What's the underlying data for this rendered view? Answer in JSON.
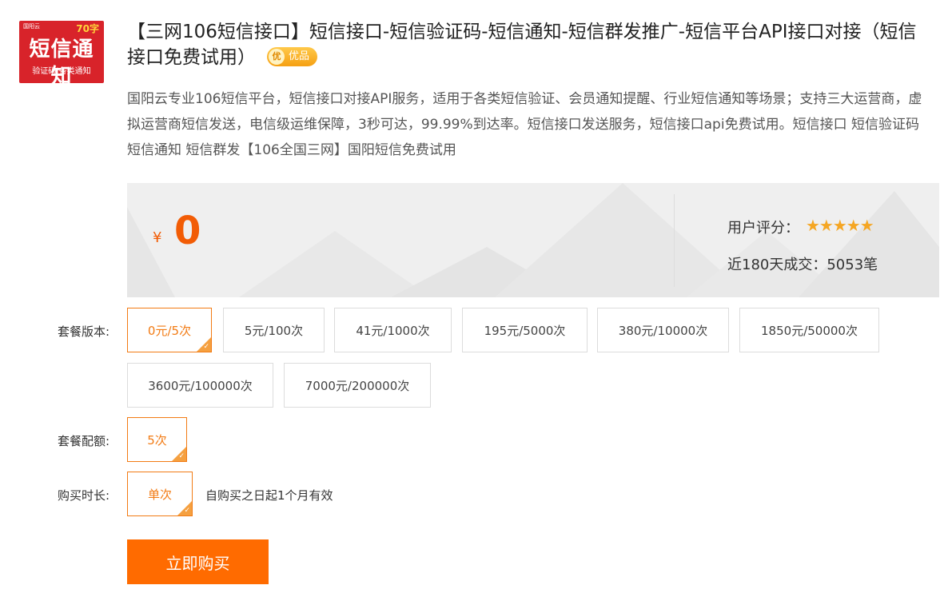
{
  "thumbnail": {
    "logo": "国阳云",
    "chars_badge": "70字",
    "title": "短信通知",
    "subtitle": "验证码|各类通知"
  },
  "product": {
    "title": "【三网106短信接口】短信接口-短信验证码-短信通知-短信群发推广-短信平台API接口对接（短信接口免费试用）",
    "badge_icon": "优",
    "badge": "优品",
    "description": "国阳云专业106短信平台，短信接口对接API服务，适用于各类短信验证、会员通知提醒、行业短信通知等场景；支持三大运营商，虚拟运营商短信发送，电信级运维保障，3秒可达，99.99%到达率。短信接口发送服务，短信接口api免费试用。短信接口 短信验证码 短信通知 短信群发【106全国三网】国阳短信免费试用"
  },
  "price": {
    "symbol": "¥",
    "value": "0"
  },
  "rating": {
    "label": "用户评分：",
    "stars": 5,
    "stars_text": "★★★★★",
    "sales_text": "近180天成交：5053笔"
  },
  "options": {
    "version": {
      "label": "套餐版本:",
      "items": [
        "0元/5次",
        "5元/100次",
        "41元/1000次",
        "195元/5000次",
        "380元/10000次",
        "1850元/50000次",
        "3600元/100000次",
        "7000元/200000次"
      ],
      "selected_index": 0
    },
    "quota": {
      "label": "套餐配额:",
      "items": [
        "5次"
      ],
      "selected_index": 0
    },
    "duration": {
      "label": "购买时长:",
      "items": [
        "单次"
      ],
      "selected_index": 0,
      "note": "自购买之日起1个月有效"
    }
  },
  "buy_button": "立即购买",
  "colors": {
    "accent": "#ff6b00",
    "price": "#f25c05",
    "selected_border": "#f27b14",
    "star": "#f5a623",
    "thumb_bg": "#d8232a"
  }
}
